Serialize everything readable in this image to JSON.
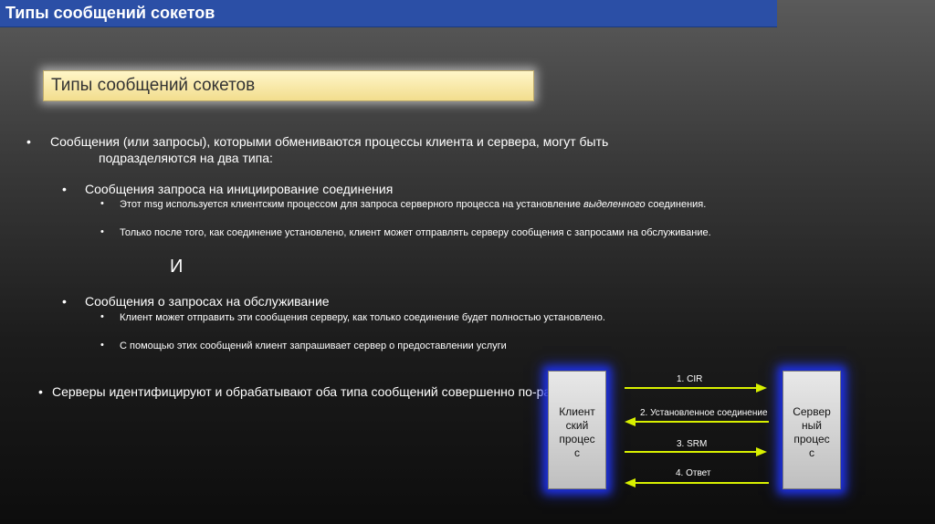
{
  "header": {
    "title": "Типы сообщений сокетов"
  },
  "subtitle": "Типы сообщений сокетов",
  "bullets": {
    "main_1_line1": "Сообщения (или запросы), которыми обмениваются процессы клиента и сервера, могут быть",
    "main_1_line2": "подразделяются на два типа:",
    "sub_1": "Сообщения запроса на инициирование соединения",
    "sub_1_item_1_a": "Этот msg используется клиентским процессом для запроса серверного процесса на установление ",
    "sub_1_item_1_b": "выделенного",
    "sub_1_item_1_c": " соединения.",
    "sub_1_item_2": "Только после того, как соединение установлено, клиент может отправлять серверу сообщения с запросами на обслуживание.",
    "connector": "И",
    "sub_2": "Сообщения о запросах на обслуживание",
    "sub_2_item_1": "Клиент может отправить эти сообщения серверу, как только соединение будет полностью установлено.",
    "sub_2_item_2": "С помощью этих сообщений клиент запрашивает сервер о предоставлении услуги",
    "main_2": "Серверы идентифицируют и обрабатывают оба типа сообщений совершенно по-разному"
  },
  "bullet_symbol": "•",
  "diagram": {
    "client_lines": [
      "Клиент",
      "ский",
      "процес",
      "с"
    ],
    "server_lines": [
      "Сервер",
      "ный",
      "процес",
      "с"
    ],
    "arrows": [
      {
        "label": "1. CIR",
        "direction": "right"
      },
      {
        "label": "2. Установленное соединение",
        "direction": "left"
      },
      {
        "label": "3. SRM",
        "direction": "right"
      },
      {
        "label": "4. Ответ",
        "direction": "left"
      }
    ]
  },
  "colors": {
    "header_bg": "#2b4fa6",
    "header_text": "#ffffff",
    "subtitle_bg": "#f2dd8e",
    "arrow": "#d8f000",
    "box_glow": "#1d2fd9"
  }
}
